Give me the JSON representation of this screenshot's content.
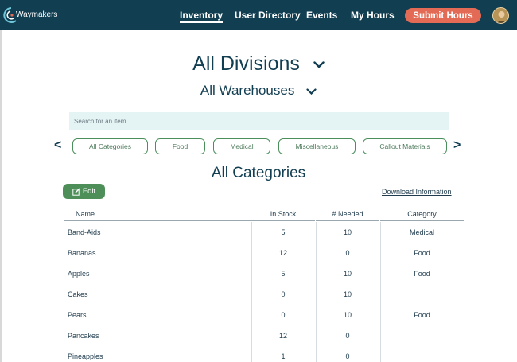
{
  "brand": {
    "name": "Waymakers"
  },
  "nav": {
    "items": [
      {
        "label": "Inventory",
        "active": true
      },
      {
        "label": "User Directory",
        "active": false
      },
      {
        "label": "Events",
        "active": false
      },
      {
        "label": "My Hours",
        "active": false
      }
    ],
    "submit_label": "Submit Hours"
  },
  "header": {
    "division": "All Divisions",
    "warehouse": "All Warehouses"
  },
  "search": {
    "placeholder": "Search for an item...",
    "value": ""
  },
  "categories": {
    "chips": [
      "All Categories",
      "Food",
      "Medical",
      "Miscellaneous",
      "Callout Materials"
    ],
    "prev_arrow": "<",
    "next_arrow": ">"
  },
  "section_title": "All Categories",
  "actions": {
    "edit_label": "Edit",
    "download_label": "Download Information"
  },
  "table": {
    "columns": [
      "Name",
      "In Stock",
      "# Needed",
      "Category"
    ],
    "rows": [
      {
        "name": "Band-Aids",
        "in_stock": "5",
        "needed": "10",
        "category": "Medical"
      },
      {
        "name": "Bananas",
        "in_stock": "12",
        "needed": "0",
        "category": "Food"
      },
      {
        "name": "Apples",
        "in_stock": "5",
        "needed": "10",
        "category": "Food"
      },
      {
        "name": "Cakes",
        "in_stock": "0",
        "needed": "10",
        "category": ""
      },
      {
        "name": "Pears",
        "in_stock": "0",
        "needed": "10",
        "category": "Food"
      },
      {
        "name": "Pancakes",
        "in_stock": "12",
        "needed": "0",
        "category": ""
      },
      {
        "name": "Pineapples",
        "in_stock": "1",
        "needed": "0",
        "category": ""
      }
    ]
  },
  "colors": {
    "nav_bg": "#123e52",
    "accent_red": "#e36b55",
    "accent_green": "#4e8f59",
    "search_bg": "#e4f3f4"
  }
}
